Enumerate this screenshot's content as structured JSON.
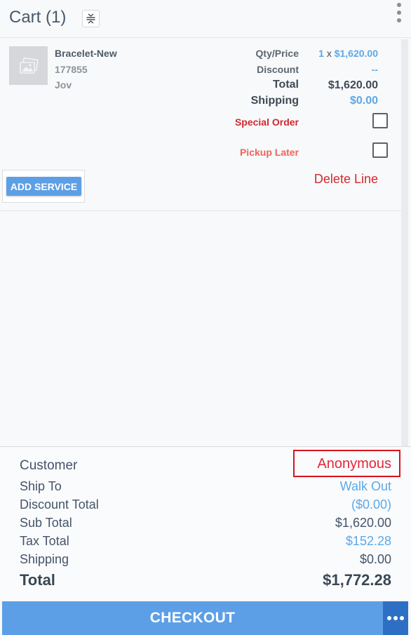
{
  "header": {
    "title": "Cart (1)"
  },
  "item": {
    "name": "Bracelet-New",
    "sku": "177855",
    "vendor": "Jov",
    "qty_price_label": "Qty/Price",
    "qty": "1",
    "qty_sep": "x",
    "price": "$1,620.00",
    "discount_label": "Discount",
    "discount_value": "--",
    "total_label": "Total",
    "total_value": "$1,620.00",
    "shipping_label": "Shipping",
    "shipping_value": "$0.00",
    "special_order_label": "Special Order",
    "special_order_checked": false,
    "pickup_later_label": "Pickup Later",
    "pickup_later_checked": false,
    "add_service_label": "ADD SERVICE",
    "delete_line_label": "Delete Line"
  },
  "summary": {
    "customer_label": "Customer",
    "customer_value": "Anonymous",
    "ship_to_label": "Ship To",
    "ship_to_value": "Walk Out",
    "discount_total_label": "Discount Total",
    "discount_total_value": "($0.00)",
    "sub_total_label": "Sub Total",
    "sub_total_value": "$1,620.00",
    "tax_total_label": "Tax Total",
    "tax_total_value": "$152.28",
    "shipping_label": "Shipping",
    "shipping_value": "$0.00",
    "total_label": "Total",
    "total_value": "$1,772.28"
  },
  "footer": {
    "checkout_label": "CHECKOUT"
  },
  "icons": {
    "collapse": "collapse-vertical-icon",
    "menu": "kebab-menu-icon",
    "thumbnail": "image-placeholder-icon",
    "more": "more-horizontal-icon"
  },
  "colors": {
    "accent_blue": "#5ca8e8",
    "button_blue": "#5d9fe6",
    "dark_button_blue": "#2e6fc6",
    "alert_red": "#d0292f",
    "highlight_red": "#d9131f"
  }
}
